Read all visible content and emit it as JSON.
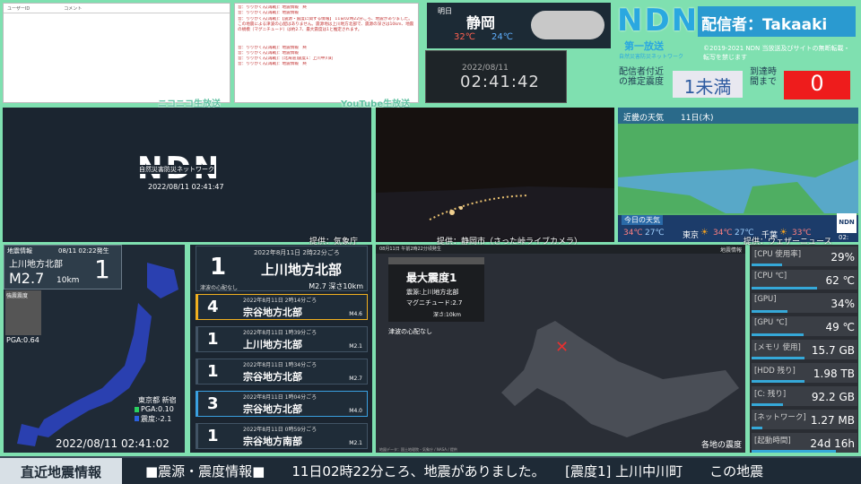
{
  "comments": {
    "col1": "ユーザーID",
    "col2": "コメント"
  },
  "youtube_chat": {
    "lines": [
      "音：りりかくん[再戦]：地震情報　終",
      "音：りりかくん[再戦]：地震情報",
      "音：りりかくん[再戦]：【震源・震度に関する情報】 11日02時22分ごろ、地震がありました。この地震による津波の心配はありません。震源地は上川地方北部で、震源の深さは10km、地震の規模（マグニチュード）は約2.7、最大震度は1と推定されます。",
      "音：りりかくん[再戦]：地震情報　終",
      "音：りりかくん[再戦]：地震情報",
      "音：りりかくん[再戦]：[北海道]震度1：上川中川町",
      "音：りりかくん[再戦]：地震情報　終"
    ]
  },
  "labels": {
    "niconico": "ニコニコ生放送",
    "youtube": "YouTube生放送",
    "prov_kishocho": "提供：気象庁",
    "prov_cam": "提供：静岡市（さった峠ライブカメラ）",
    "prov_weather": "提供：ウェザーニュース"
  },
  "weather_tomorrow": {
    "label": "明日",
    "city": "静岡",
    "high": "32℃",
    "low": "24℃"
  },
  "clock": {
    "date": "2022/08/11",
    "time": "02:41:42"
  },
  "ndn": {
    "logo": "NDN",
    "sub": "第一放送",
    "sub2": "自然災害防災ネットワーク",
    "streamer": "配信者：Takaaki",
    "copyright": "©2019-2021 NDN 当放送及びサイトの無断転載・転写を禁じます",
    "est_label": "配信者付近の推定震度",
    "est_value": "1未満",
    "arrival_label": "到達時間まで",
    "arrival_value": "0"
  },
  "niconico": {
    "logo": "NDN",
    "sub": "自然災害防災ネットワーク",
    "time": "2022/08/11 02:41:47"
  },
  "kinki": {
    "title": "近畿の天気",
    "date": "11日(木)",
    "today_label": "今日の天気",
    "cities": [
      {
        "hi": "34℃",
        "lo": "27℃",
        "name": "東京"
      },
      {
        "hi": "34℃",
        "lo": "27℃",
        "name": "千葉"
      },
      {
        "hi": "33℃",
        "lo": "",
        "name": ""
      }
    ],
    "ndn_badge": "NDN",
    "badge_time": "02:"
  },
  "quake_map": {
    "title": "地震情報",
    "issued": "08/11 02:22発生",
    "place": "上川地方北部",
    "mag": "M2.7",
    "depth": "10km",
    "intensity": "1",
    "strong": "強震震度",
    "pga": "PGA:0.64",
    "station": "東京都 新宿",
    "pga2": "PGA:0.10",
    "shindo": "震度:-2.1",
    "timestamp": "2022/08/11 02:41:02"
  },
  "quake_list": {
    "latest": {
      "int": "1",
      "time": "2022年8月11日 2時22分ごろ",
      "place": "上川地方北部",
      "tsunami": "津波の心配なし",
      "magdepth": "M2.7 深さ10km"
    },
    "items": [
      {
        "int": "4",
        "time": "2022年8月11日 2時14分ごろ",
        "place": "宗谷地方北部",
        "mag": "M4.6",
        "color": "#f0b020"
      },
      {
        "int": "1",
        "time": "2022年8月11日 1時39分ごろ",
        "place": "上川地方北部",
        "mag": "M2.1",
        "color": "#415364"
      },
      {
        "int": "1",
        "time": "2022年8月11日 1時34分ごろ",
        "place": "宗谷地方北部",
        "mag": "M2.7",
        "color": "#415364"
      },
      {
        "int": "3",
        "time": "2022年8月11日 1時04分ごろ",
        "place": "宗谷地方北部",
        "mag": "M4.0",
        "color": "#3aa0e0"
      },
      {
        "int": "1",
        "time": "2022年8月11日 0時59分ごろ",
        "place": "宗谷地方南部",
        "mag": "M2.1",
        "color": "#415364"
      }
    ]
  },
  "hokkaido": {
    "header": "08月11日 午前2時22分頃発生",
    "tag": "地震情報",
    "max_label": "最大震度1",
    "epicenter": "震源:上川地方北部",
    "magnitude": "マグニチュード:2.7",
    "depth": "深さ:10km",
    "tsunami": "津波の心配なし",
    "footer": "各地の震度",
    "credit": "地図データ：国土地理院・気象庁 / NASA / 提供"
  },
  "stats": [
    {
      "k": "[CPU 使用率]",
      "v": "29%",
      "fill": 0.29
    },
    {
      "k": "[CPU ℃]",
      "v": "62 ℃",
      "fill": 0.62
    },
    {
      "k": "[GPU]",
      "v": "34%",
      "fill": 0.34
    },
    {
      "k": "[GPU ℃]",
      "v": "49 ℃",
      "fill": 0.49
    },
    {
      "k": "[メモリ 使用]",
      "v": "15.7 GB",
      "fill": 0.5
    },
    {
      "k": "[HDD 残り]",
      "v": "1.98 TB",
      "fill": 0.5
    },
    {
      "k": "[C: 残り]",
      "v": "92.2 GB",
      "fill": 0.3
    },
    {
      "k": "[ネットワーク]",
      "v": "1.27 MB",
      "fill": 0.1
    },
    {
      "k": "[起動時間]",
      "v": "24d 16h",
      "fill": 0.8
    }
  ],
  "ticker": {
    "label": "直近地震情報",
    "text": "■震源・震度情報■　　11日02時22分ころ、地震がありました。　　[震度1] 上川中川町　　この地震"
  }
}
